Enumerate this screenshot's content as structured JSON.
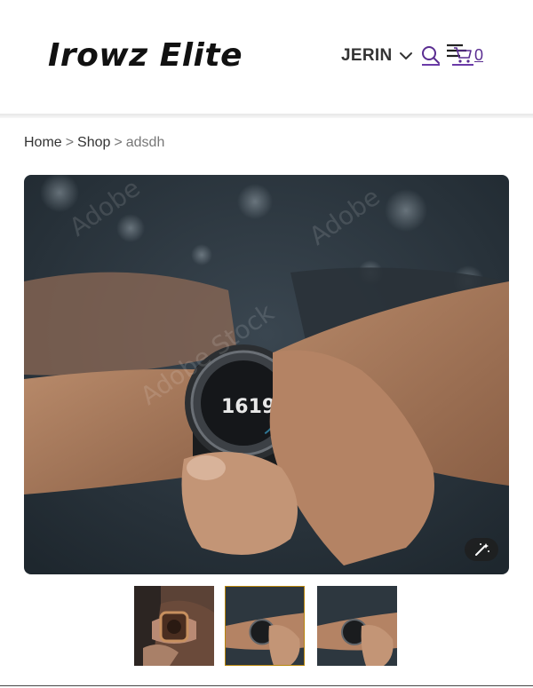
{
  "header": {
    "logo": "Irowz Elite",
    "user_name": "JERIN",
    "cart_count": "0"
  },
  "breadcrumb": {
    "home": "Home",
    "shop": "Shop",
    "current": "adsdh",
    "separator": ">"
  },
  "product_gallery": {
    "thumbnails": [
      "thumbnail-1",
      "thumbnail-2",
      "thumbnail-3"
    ],
    "selected_thumbnail": 1
  },
  "icons": {
    "search": "search-icon",
    "menu": "hamburger-icon",
    "cart": "cart-icon",
    "dropdown": "chevron-down-icon",
    "zoom": "magic-wand-icon"
  },
  "colors": {
    "link": "#5a2d91",
    "selected_border": "#b8860b"
  }
}
